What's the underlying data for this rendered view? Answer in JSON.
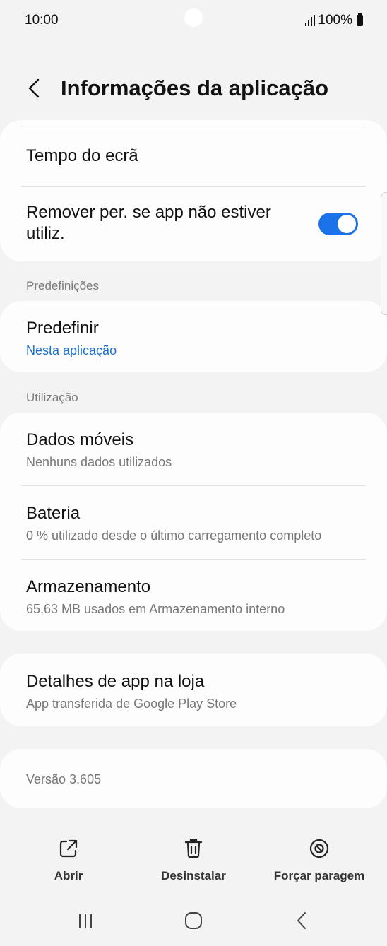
{
  "status_bar": {
    "time": "10:00",
    "battery": "100%"
  },
  "header": {
    "title": "Informações da aplicação"
  },
  "card1": {
    "screen_time": "Tempo do ecrã",
    "remove_permissions_line1": "Remover per. se app não estiver",
    "remove_permissions_line2": "utiliz.",
    "toggle_on": true
  },
  "defaults_section": {
    "label": "Predefinições",
    "title": "Predefinir",
    "subtitle": "Nesta aplicação"
  },
  "usage_section": {
    "label": "Utilização",
    "items": [
      {
        "title": "Dados móveis",
        "subtitle": "Nenhuns dados utilizados"
      },
      {
        "title": "Bateria",
        "subtitle": "0 % utilizado desde o último carregamento completo"
      },
      {
        "title": "Armazenamento",
        "subtitle": "65,63 MB usados em Armazenamento interno"
      }
    ]
  },
  "store": {
    "title": "Detalhes de app na loja",
    "subtitle": "App transferida de Google Play Store"
  },
  "version": {
    "text": "Versão 3.605"
  },
  "actions": {
    "open": "Abrir",
    "uninstall": "Desinstalar",
    "force_stop": "Forçar paragem"
  },
  "colors": {
    "accent": "#1a73e8",
    "link": "#1a6fcf",
    "background": "#f3f3f3",
    "card": "#fdfdfd"
  },
  "icons": {
    "back": "chevron-left-icon",
    "open": "open-external-icon",
    "uninstall": "trash-icon",
    "force_stop": "stop-circle-icon",
    "nav_recent": "recents-icon",
    "nav_home": "home-icon",
    "nav_back": "back-icon"
  }
}
